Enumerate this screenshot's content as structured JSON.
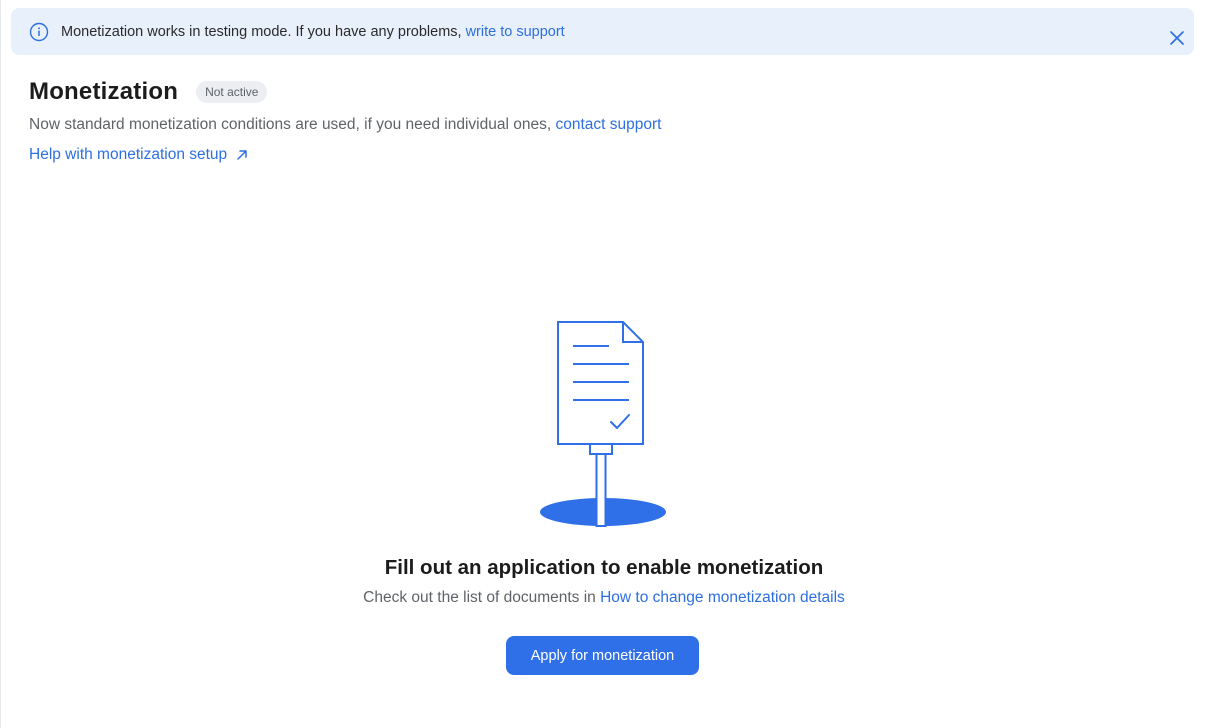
{
  "banner": {
    "message": "Monetization works in testing mode. If you have any problems,",
    "link": "write to support",
    "icon": "info-icon",
    "close_icon": "close-icon"
  },
  "header": {
    "title": "Monetization",
    "status": "Not active",
    "subtitle": "Now standard monetization conditions are used, if you need individual ones,",
    "subtitle_link": "contact support",
    "help_link": "Help with monetization setup",
    "help_icon": "external-link-arrow-icon"
  },
  "empty_state": {
    "illustration": "document-stand-icon",
    "title": "Fill out an application to enable monetization",
    "description": "Check out the list of documents in",
    "description_link": "How to change monetization details",
    "button_label": "Apply for monetization"
  },
  "colors": {
    "accent": "#2f6fe8",
    "link": "#2d6fe0",
    "banner_bg": "#e8f0fb",
    "badge_bg": "#eceef1"
  }
}
